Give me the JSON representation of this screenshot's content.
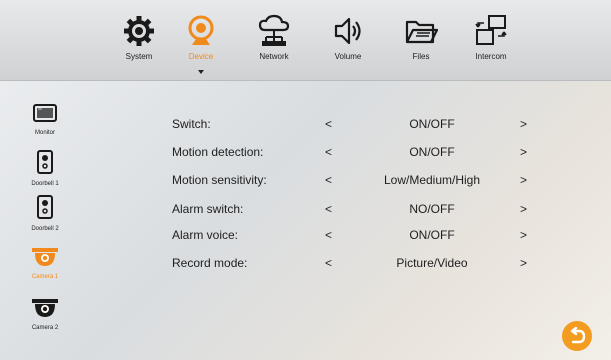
{
  "tabs": [
    {
      "label": "System",
      "icon": "gear-icon"
    },
    {
      "label": "Device",
      "icon": "webcam-icon"
    },
    {
      "label": "Network",
      "icon": "cloud-network-icon"
    },
    {
      "label": "Volume",
      "icon": "speaker-icon"
    },
    {
      "label": "Files",
      "icon": "folder-icon"
    },
    {
      "label": "Intercom",
      "icon": "intercom-icon"
    }
  ],
  "active_tab": "Device",
  "sidebar": [
    {
      "label": "Monitor",
      "icon": "monitor-icon"
    },
    {
      "label": "Doorbell 1",
      "icon": "doorbell-icon"
    },
    {
      "label": "Doorbell 2",
      "icon": "doorbell-icon"
    },
    {
      "label": "Camera 1",
      "icon": "dome-camera-icon"
    },
    {
      "label": "Camera 2",
      "icon": "dome-camera-icon"
    }
  ],
  "active_sidebar": "Camera 1",
  "settings": [
    {
      "name": "Switch:",
      "value": "ON/OFF"
    },
    {
      "name": "Motion detection:",
      "value": "ON/OFF"
    },
    {
      "name": "Motion sensitivity:",
      "value": "Low/Medium/High"
    },
    {
      "name": "Alarm switch:",
      "value": "NO/OFF"
    },
    {
      "name": "Alarm voice:",
      "value": "ON/OFF"
    },
    {
      "name": "Record mode:",
      "value": "Picture/Video"
    }
  ],
  "arrows": {
    "prev": "<",
    "next": ">"
  },
  "colors": {
    "accent": "#f08a1c",
    "text": "#1e1e1e"
  }
}
